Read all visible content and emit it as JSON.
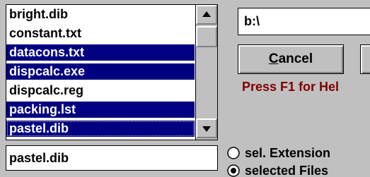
{
  "file_list": {
    "items": [
      {
        "name": "bright.dib",
        "selected": false,
        "focused": false
      },
      {
        "name": "constant.txt",
        "selected": false,
        "focused": false
      },
      {
        "name": "datacons.txt",
        "selected": true,
        "focused": false
      },
      {
        "name": "dispcalc.exe",
        "selected": true,
        "focused": false
      },
      {
        "name": "dispcalc.reg",
        "selected": false,
        "focused": false
      },
      {
        "name": "packing.lst",
        "selected": true,
        "focused": false
      },
      {
        "name": "pastel.dib",
        "selected": true,
        "focused": true
      }
    ]
  },
  "filename_field": {
    "value": "pastel.dib"
  },
  "path_field": {
    "value": "b:\\"
  },
  "buttons": {
    "cancel_mnemonic": "C",
    "cancel_rest": "ancel"
  },
  "hint": "Press F1 for Hel",
  "radios": {
    "extension": {
      "label": "sel. Extension",
      "checked": false
    },
    "files": {
      "label": "selected Files",
      "checked": true
    }
  },
  "colors": {
    "selection": "#000080",
    "hint": "#800000",
    "face": "#c0c0c0"
  },
  "icons": {
    "scroll_up": "up-arrow-icon",
    "scroll_down": "down-arrow-icon"
  }
}
